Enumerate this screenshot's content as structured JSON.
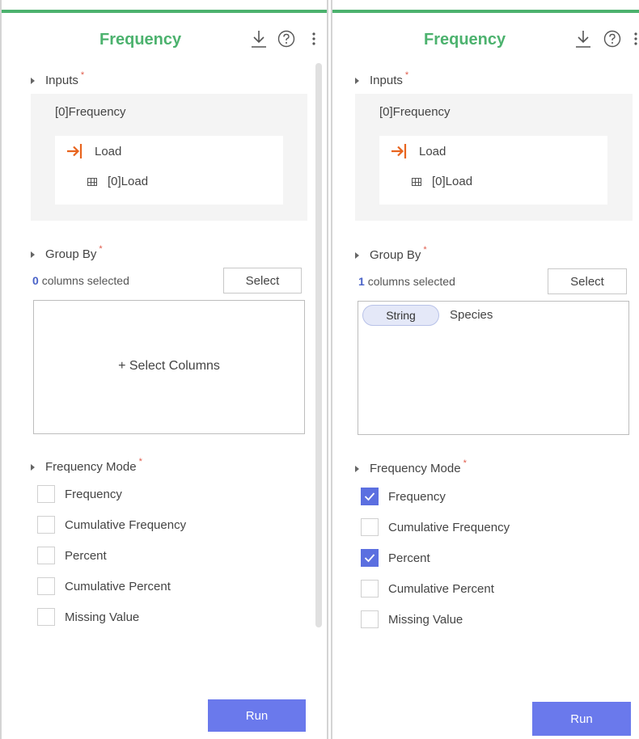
{
  "left_panel": {
    "title": "Frequency",
    "header_icons": [
      "download-icon",
      "help-icon",
      "more-options-icon"
    ],
    "inputs": {
      "label": "Inputs",
      "required_mark": "*",
      "source": "[0]Frequency",
      "node_label": "Load",
      "table_label": "[0]Load"
    },
    "group_by": {
      "label": "Group By",
      "required_mark": "*",
      "count": "0",
      "count_suffix": "columns selected",
      "select_label": "Select",
      "placeholder": "+ Select Columns"
    },
    "mode": {
      "label": "Frequency Mode",
      "required_mark": "*",
      "options": [
        {
          "label": "Frequency",
          "checked": false
        },
        {
          "label": "Cumulative Frequency",
          "checked": false
        },
        {
          "label": "Percent",
          "checked": false
        },
        {
          "label": "Cumulative Percent",
          "checked": false
        },
        {
          "label": "Missing Value",
          "checked": false
        }
      ]
    },
    "run_label": "Run"
  },
  "right_panel": {
    "title": "Frequency",
    "header_icons": [
      "download-icon",
      "help-icon",
      "more-options-icon"
    ],
    "inputs": {
      "label": "Inputs",
      "required_mark": "*",
      "source": "[0]Frequency",
      "node_label": "Load",
      "table_label": "[0]Load"
    },
    "group_by": {
      "label": "Group By",
      "required_mark": "*",
      "count": "1",
      "count_suffix": "columns selected",
      "select_label": "Select",
      "selected_columns": [
        {
          "type": "String",
          "name": "Species"
        }
      ]
    },
    "mode": {
      "label": "Frequency Mode",
      "required_mark": "*",
      "options": [
        {
          "label": "Frequency",
          "checked": true
        },
        {
          "label": "Cumulative Frequency",
          "checked": false
        },
        {
          "label": "Percent",
          "checked": true
        },
        {
          "label": "Cumulative Percent",
          "checked": false
        },
        {
          "label": "Missing Value",
          "checked": false
        }
      ]
    },
    "run_label": "Run"
  },
  "colors": {
    "accent_green": "#4cb26e",
    "load_orange": "#e8641e",
    "checkbox_blue": "#5b6fe0",
    "run_button": "#6a79ec",
    "required_red": "#e05b4b"
  }
}
